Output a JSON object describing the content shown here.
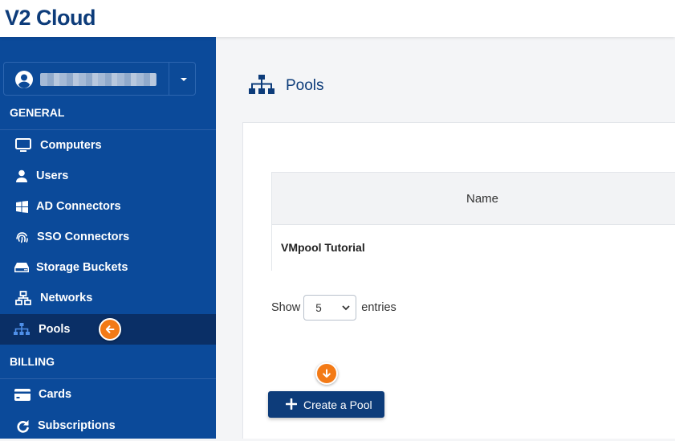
{
  "app": {
    "logo_text": "V2 Cloud"
  },
  "sidebar": {
    "sections": [
      {
        "title": "GENERAL"
      },
      {
        "title": "BILLING"
      }
    ],
    "items": [
      {
        "label": "Computers",
        "icon": "monitor-icon"
      },
      {
        "label": "Users",
        "icon": "user-icon"
      },
      {
        "label": "AD Connectors",
        "icon": "windows-icon"
      },
      {
        "label": "SSO Connectors",
        "icon": "fingerprint-icon"
      },
      {
        "label": "Storage Buckets",
        "icon": "hard-drive-icon"
      },
      {
        "label": "Networks",
        "icon": "network-icon"
      },
      {
        "label": "Pools",
        "icon": "sitemap-icon",
        "active": true
      },
      {
        "label": "Cards",
        "icon": "credit-card-icon"
      },
      {
        "label": "Subscriptions",
        "icon": "redo-icon"
      }
    ]
  },
  "page": {
    "title": "Pools",
    "table": {
      "columns": [
        "Name"
      ],
      "rows": [
        [
          "VMpool Tutorial"
        ]
      ]
    },
    "length_menu": {
      "prefix": "Show",
      "selected": "5",
      "suffix": "entries"
    },
    "create_button_label": "Create a Pool"
  },
  "colors": {
    "sidebar": "#0b4a9a",
    "sidebar_active": "#0a2f66",
    "brand": "#0d3c7a",
    "highlight_badge": "#f37a16"
  }
}
